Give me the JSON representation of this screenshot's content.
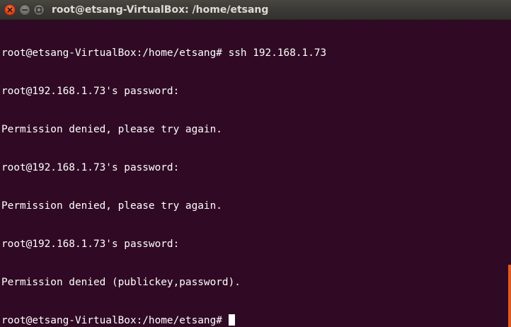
{
  "window": {
    "title": "root@etsang-VirtualBox: /home/etsang"
  },
  "terminal": {
    "lines": [
      "root@etsang-VirtualBox:/home/etsang# ssh 192.168.1.73",
      "root@192.168.1.73's password:",
      "Permission denied, please try again.",
      "root@192.168.1.73's password:",
      "Permission denied, please try again.",
      "root@192.168.1.73's password:",
      "Permission denied (publickey,password).",
      "root@etsang-VirtualBox:/home/etsang# "
    ]
  },
  "colors": {
    "background": "#300a24",
    "foreground": "#ffffff",
    "titlebar": "#3c3b37",
    "close_button": "#e0431a",
    "accent": "#e05a1f"
  },
  "icons": {
    "close": "close-icon",
    "minimize": "minimize-icon",
    "maximize": "maximize-icon"
  }
}
